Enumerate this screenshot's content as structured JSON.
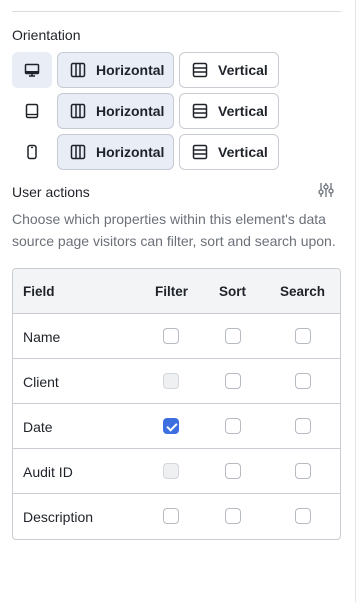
{
  "orientation": {
    "title": "Orientation",
    "rows": [
      {
        "device": "desktop-icon",
        "horizontal_label": "Horizontal",
        "vertical_label": "Vertical",
        "selected": "horizontal"
      },
      {
        "device": "tablet-icon",
        "horizontal_label": "Horizontal",
        "vertical_label": "Vertical",
        "selected": "horizontal"
      },
      {
        "device": "mobile-icon",
        "horizontal_label": "Horizontal",
        "vertical_label": "Vertical",
        "selected": "horizontal"
      }
    ]
  },
  "user_actions": {
    "title": "User actions",
    "settings_icon": "sliders-icon",
    "description": "Choose which properties within this element's data source page visitors can filter, sort and search upon."
  },
  "table": {
    "headers": {
      "field": "Field",
      "filter": "Filter",
      "sort": "Sort",
      "search": "Search"
    },
    "rows": [
      {
        "name": "Name",
        "filter": "unchecked",
        "sort": "unchecked",
        "search": "unchecked"
      },
      {
        "name": "Client",
        "filter": "disabled",
        "sort": "unchecked",
        "search": "unchecked"
      },
      {
        "name": "Date",
        "filter": "checked",
        "sort": "unchecked",
        "search": "unchecked"
      },
      {
        "name": "Audit ID",
        "filter": "disabled",
        "sort": "unchecked",
        "search": "unchecked"
      },
      {
        "name": "Description",
        "filter": "unchecked",
        "sort": "unchecked",
        "search": "unchecked"
      }
    ]
  },
  "colors": {
    "accent": "#3d6fe0",
    "selected_bg": "#e8edf6",
    "border": "#c9ccd2",
    "muted_text": "#6b7079"
  }
}
